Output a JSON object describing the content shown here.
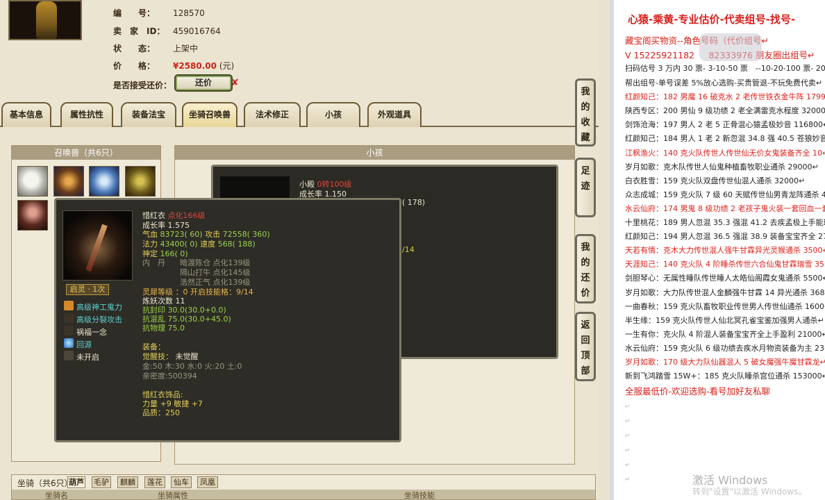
{
  "listing": {
    "id_label": "编　　号：",
    "id_value": "128570",
    "seller_label": "卖　家　ID：",
    "seller_value": "459016764",
    "status_label": "状　　态：",
    "status_value": "上架中",
    "price_label": "价　　格：",
    "price_value": "¥2580.00",
    "price_unit": "(元)",
    "haggle_label": "是否接受还价：",
    "haggle_button": "还价",
    "haggle_x": "✘"
  },
  "tabs": [
    "基本信息",
    "属性抗性",
    "装备法宝",
    "坐骑召唤兽",
    "法术修正",
    "小孩",
    "外观道具"
  ],
  "active_tab": "坐骑召唤兽",
  "summon_panel_title": "召唤兽（共6只）",
  "child_panel_title": "小孩",
  "back_tooltip": {
    "name": "小殿",
    "level": "0转100级",
    "growth": "成长率 1.150",
    "frag": "( 178)",
    "frag2": "/14"
  },
  "tooltip": {
    "name": "惜红衣",
    "level": "点化166级",
    "growth": "成长率 1.575",
    "hp_label": "气血",
    "hp": "83723( 60)",
    "atk_label": "攻击",
    "atk": "72558( 360)",
    "mp_label": "法力",
    "mp": "43400( 0)",
    "spd_label": "速度",
    "spd": "568( 188)",
    "mind_label": "神定",
    "mind": "166( 0)",
    "neidan_label": "内　丹",
    "neidan": [
      "暗渡陈仓 点化139级",
      "隔山打牛 点化145级",
      "浩然正气 点化139级"
    ],
    "lingjie": "灵犀等级 ：0 开启技能格：9/14",
    "lianyao": "炼妖次数 11",
    "resist": [
      "抗封印 30.0(30.0+0.0)",
      "抗混乱 75.0(30.0+45.0)",
      "抗物理 75.0"
    ],
    "badge": "启灵 · 1次",
    "skills": [
      "高级神工鬼力",
      "高级分裂攻击",
      "祸福一念",
      "回源",
      "未开启"
    ],
    "equip_label": "装备：",
    "awaken_label": "觉醒技：",
    "awaken_value": "未觉醒",
    "elements": "金:50 木:30 水:0 火:20 土:0",
    "intimacy": "亲密度:500394",
    "accessory_label": "惜红衣饰品:",
    "accessory_stats": "力量 +9 敏捷 +7",
    "quality": "品质：250"
  },
  "bottom": {
    "label": "坐骑（共6只）",
    "subtabs": [
      "葫芦",
      "毛驴",
      "麒麟",
      "莲花",
      "仙车",
      "凤凰"
    ],
    "active_subtab": "葫芦",
    "cols": [
      "坐骑名",
      "坐骑属性",
      "坐骑技能"
    ]
  },
  "side_buttons": [
    "我的收藏",
    "足迹",
    "我的还价",
    "返回顶部"
  ],
  "notepad": {
    "title": "心猿-乘黄-专业估价-代卖组号-找号-",
    "lines": [
      {
        "t": "藏宝阁买物资--角色号码（代价组号",
        "c": "redb"
      },
      {
        "t": "V 15225921182 　 82333976 朋友圈出组号",
        "c": "redb"
      },
      {
        "t": "扫码估号 3 万内 30 票- 3-10-50 票　--10-20-100 票- 20 以上 1",
        "c": ""
      },
      {
        "t": "帮出组号-单号误差 5%放心选购-买贵管退-不玩免费代卖",
        "c": ""
      },
      {
        "t": "红颜知己：182 男魔 16 破克水 2 老传世铁衣金牛阵 17999",
        "c": "red"
      },
      {
        "t": "陕西专区：200 男仙 9 级功绩 2 老全满雷克水程度 32000",
        "c": ""
      },
      {
        "t": "剑饰沧海：197 男人 2 老 5 正骨混心猿孟极妙音 116800",
        "c": ""
      },
      {
        "t": "红颜知己：184 男人 1 老 2 新忽混 34.8 强 40.5 苍狼妙音 22",
        "c": ""
      },
      {
        "t": "江枫渔火：140 克火队传世人传世仙无价女鬼装备齐全 10",
        "c": "red"
      },
      {
        "t": "岁月如歌：克木队传世人仙鬼种植畜牧职业通杀 29000",
        "c": ""
      },
      {
        "t": "白衣胜雪：159 克火队双盘传世仙混人通杀 32000",
        "c": ""
      },
      {
        "t": "众志成城：159 克火队 7 级 60 天赋传世仙男青龙阵通杀 4",
        "c": ""
      },
      {
        "t": "水云仙府：174 男鬼 8 级功绩 2 老孩子鬼火装一套回血一套",
        "c": "red"
      },
      {
        "t": "十里桃花：189 男人忽混 35.3 强混 41.2 去疾孟极上手能玩",
        "c": ""
      },
      {
        "t": "红颜知己：194 男人忽混 36.5 强混 38.9 装备宝宝齐全 275",
        "c": ""
      },
      {
        "t": "天若有情：克木大力传世混人强牛甘霖异光灵猴通杀 3500",
        "c": "red"
      },
      {
        "t": "天涯知己：140 克火队 4 阶睡杀传世六合仙鬼甘霖瑞雪 35",
        "c": "red"
      },
      {
        "t": "剑胆琴心：无属性睡队传世睡人太皓仙阁霞女鬼通杀 5500",
        "c": ""
      },
      {
        "t": "岁月如歌：大力队传世混人金麟强牛甘霖 14 异光通杀 368",
        "c": ""
      },
      {
        "t": "一曲春秋：159 克火队畜牧职业传世男人传世仙通杀 1600",
        "c": ""
      },
      {
        "t": "半生缘：159 克火队传世人仙北冥孔雀宝鉴加强男人通杀",
        "c": ""
      },
      {
        "t": "一生有你：克火队 4 阶混人装备宝宝齐全上手盈利 21000",
        "c": ""
      },
      {
        "t": "水云仙府：159 克火队 6 级功绩去疾水月物资装备为主 23",
        "c": ""
      },
      {
        "t": "岁月如歌：170 级大力队仙器混人 5 破女魔强牛魔甘霖龙",
        "c": "red"
      },
      {
        "t": "新到飞鸿踏雪 15W+：185 克火队睡杀宫位通杀 153000",
        "c": ""
      },
      {
        "t": "全服最低价-欢迎选购-看号加好友私聊",
        "c": "redb"
      }
    ],
    "para_mark": "↵",
    "watermark": "激活 Windows",
    "watermark2": "转到\"设置\"以激活 Windows。"
  }
}
